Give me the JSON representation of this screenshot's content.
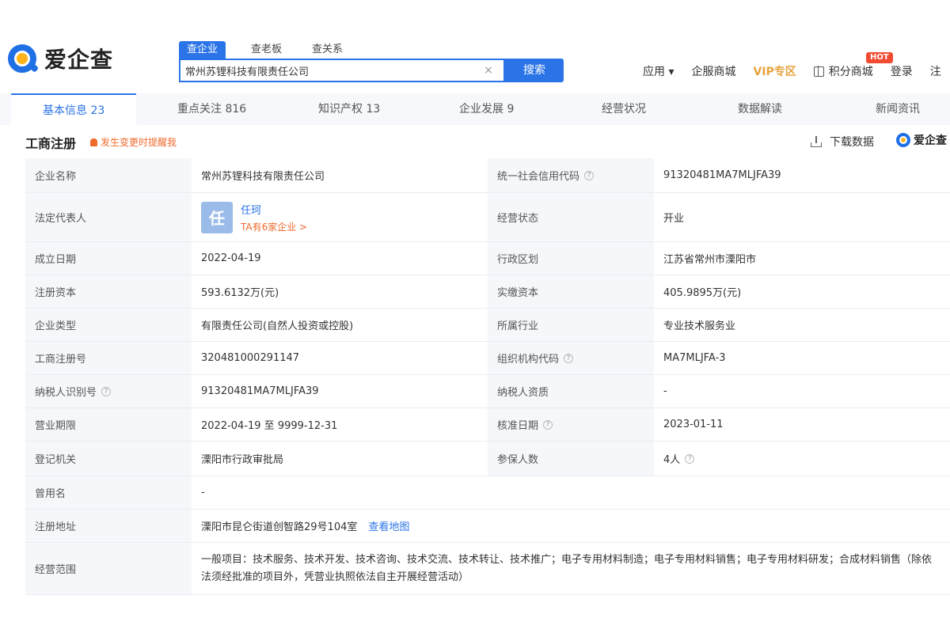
{
  "logo": {
    "text": "爱企查"
  },
  "search": {
    "tabs": [
      "查企业",
      "查老板",
      "查关系"
    ],
    "query": "常州苏锂科技有限责任公司",
    "clear_icon": "×",
    "button_label": "搜索"
  },
  "nav": {
    "apps": "应用 ▾",
    "service": "企服商城",
    "vip": "VIP专区",
    "points": "积分商城",
    "hot": "HOT",
    "login": "登录",
    "extra": "注"
  },
  "tabs": [
    "基本信息 23",
    "重点关注 816",
    "知识产权 13",
    "企业发展 9",
    "经营状况",
    "数据解读",
    "新闻资讯"
  ],
  "section": {
    "title": "工商注册",
    "notice": "发生变更时提醒我",
    "download": "下载数据",
    "aiqicha": "爱企查"
  },
  "info": {
    "company_name_label": "企业名称",
    "company_name": "常州苏锂科技有限责任公司",
    "credit_code_label": "统一社会信用代码",
    "credit_code": "91320481MA7MLJFA39",
    "legal_rep_label": "法定代表人",
    "legal_rep_avatar": "任",
    "legal_rep_name": "任珂",
    "legal_rep_link": "TA有6家企业 >",
    "status_label": "经营状态",
    "status": "开业",
    "founded_label": "成立日期",
    "founded": "2022-04-19",
    "region_label": "行政区划",
    "region": "江苏省常州市溧阳市",
    "reg_capital_label": "注册资本",
    "reg_capital": "593.6132万(元)",
    "paid_capital_label": "实缴资本",
    "paid_capital": "405.9895万(元)",
    "type_label": "企业类型",
    "type": "有限责任公司(自然人投资或控股)",
    "industry_label": "所属行业",
    "industry": "专业技术服务业",
    "reg_no_label": "工商注册号",
    "reg_no": "320481000291147",
    "org_code_label": "组织机构代码",
    "org_code": "MA7MLJFA-3",
    "taxpayer_id_label": "纳税人识别号",
    "taxpayer_id": "91320481MA7MLJFA39",
    "taxpayer_qual_label": "纳税人资质",
    "taxpayer_qual": "-",
    "term_label": "营业期限",
    "term": "2022-04-19 至 9999-12-31",
    "approval_date_label": "核准日期",
    "approval_date": "2023-01-11",
    "authority_label": "登记机关",
    "authority": "溧阳市行政审批局",
    "insured_label": "参保人数",
    "insured": "4人",
    "former_name_label": "曾用名",
    "former_name": "-",
    "address_label": "注册地址",
    "address": "溧阳市昆仑街道创智路29号104室",
    "map_link": "查看地图",
    "scope_label": "经营范围",
    "scope": "一般项目：技术服务、技术开发、技术咨询、技术交流、技术转让、技术推广；电子专用材料制造；电子专用材料销售；电子专用材料研发；合成材料销售（除依法须经批准的项目外，凭营业执照依法自主开展经营活动）"
  }
}
